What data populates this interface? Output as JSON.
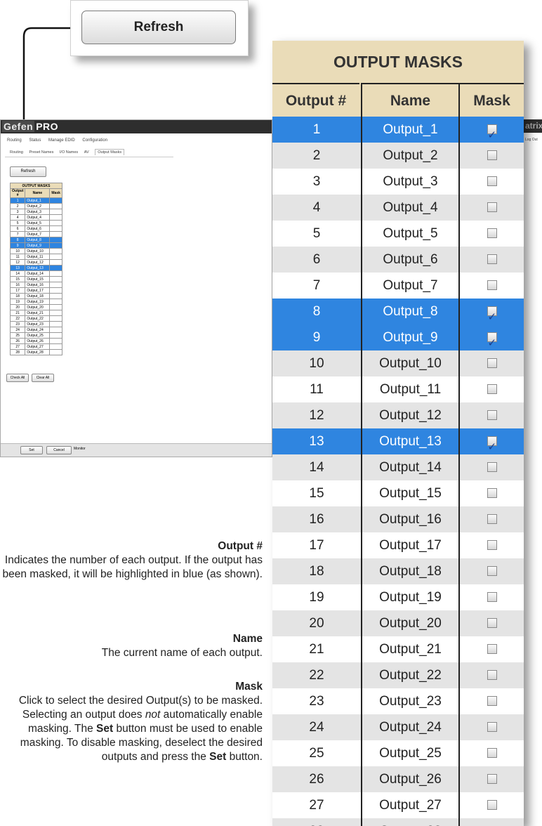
{
  "refresh_callout": {
    "label": "Refresh"
  },
  "mini_app": {
    "logo_gefen": "Gefen",
    "logo_pro": "PRO",
    "nav": [
      "Routing",
      "Status",
      "Manage EDID",
      "Configuration"
    ],
    "subnav": [
      "Routing",
      "Preset Names",
      "I/O Names",
      "AV",
      "Output Masks"
    ],
    "refresh_label": "Refresh",
    "table_title": "OUTPUT MASKS",
    "headers": [
      "Output #",
      "Name",
      "Mask"
    ],
    "check_all": "Check All",
    "clear_all": "Clear All",
    "footer": [
      "Set",
      "Cancel",
      "Monitor"
    ]
  },
  "table": {
    "title": "OUTPUT MASKS",
    "headers": {
      "output": "Output #",
      "name": "Name",
      "mask": "Mask"
    },
    "rows": [
      {
        "num": "1",
        "name": "Output_1",
        "masked": true
      },
      {
        "num": "2",
        "name": "Output_2",
        "masked": false
      },
      {
        "num": "3",
        "name": "Output_3",
        "masked": false
      },
      {
        "num": "4",
        "name": "Output_4",
        "masked": false
      },
      {
        "num": "5",
        "name": "Output_5",
        "masked": false
      },
      {
        "num": "6",
        "name": "Output_6",
        "masked": false
      },
      {
        "num": "7",
        "name": "Output_7",
        "masked": false
      },
      {
        "num": "8",
        "name": "Output_8",
        "masked": true
      },
      {
        "num": "9",
        "name": "Output_9",
        "masked": true
      },
      {
        "num": "10",
        "name": "Output_10",
        "masked": false
      },
      {
        "num": "11",
        "name": "Output_11",
        "masked": false
      },
      {
        "num": "12",
        "name": "Output_12",
        "masked": false
      },
      {
        "num": "13",
        "name": "Output_13",
        "masked": true
      },
      {
        "num": "14",
        "name": "Output_14",
        "masked": false
      },
      {
        "num": "15",
        "name": "Output_15",
        "masked": false
      },
      {
        "num": "16",
        "name": "Output_16",
        "masked": false
      },
      {
        "num": "17",
        "name": "Output_17",
        "masked": false
      },
      {
        "num": "18",
        "name": "Output_18",
        "masked": false
      },
      {
        "num": "19",
        "name": "Output_19",
        "masked": false
      },
      {
        "num": "20",
        "name": "Output_20",
        "masked": false
      },
      {
        "num": "21",
        "name": "Output_21",
        "masked": false
      },
      {
        "num": "22",
        "name": "Output_22",
        "masked": false
      },
      {
        "num": "23",
        "name": "Output_23",
        "masked": false
      },
      {
        "num": "24",
        "name": "Output_24",
        "masked": false
      },
      {
        "num": "25",
        "name": "Output_25",
        "masked": false
      },
      {
        "num": "26",
        "name": "Output_26",
        "masked": false
      },
      {
        "num": "27",
        "name": "Output_27",
        "masked": false
      },
      {
        "num": "28",
        "name": "Output_28",
        "masked": false
      }
    ]
  },
  "edge": {
    "word": "atrix",
    "logout": "Log Out"
  },
  "description": {
    "output_title": "Output #",
    "output_text": "Indicates the number of each output. If the output has been masked, it will be highlighted in blue (as shown).",
    "name_title": "Name",
    "name_text": "The current name of each output.",
    "mask_title": "Mask",
    "mask_text_1": "Click to select the desired Output(s) to be masked. Selecting an output does ",
    "mask_text_not": "not",
    "mask_text_2": " automatically enable masking. The ",
    "mask_text_set": "Set",
    "mask_text_3": " button must be used to enable masking. To disable masking, deselect the desired outputs and press the ",
    "mask_text_set2": "Set",
    "mask_text_4": " button."
  },
  "colors": {
    "masked": "#2f85e0",
    "header": "#eadcb8",
    "alt_row": "#e4e4e4"
  }
}
